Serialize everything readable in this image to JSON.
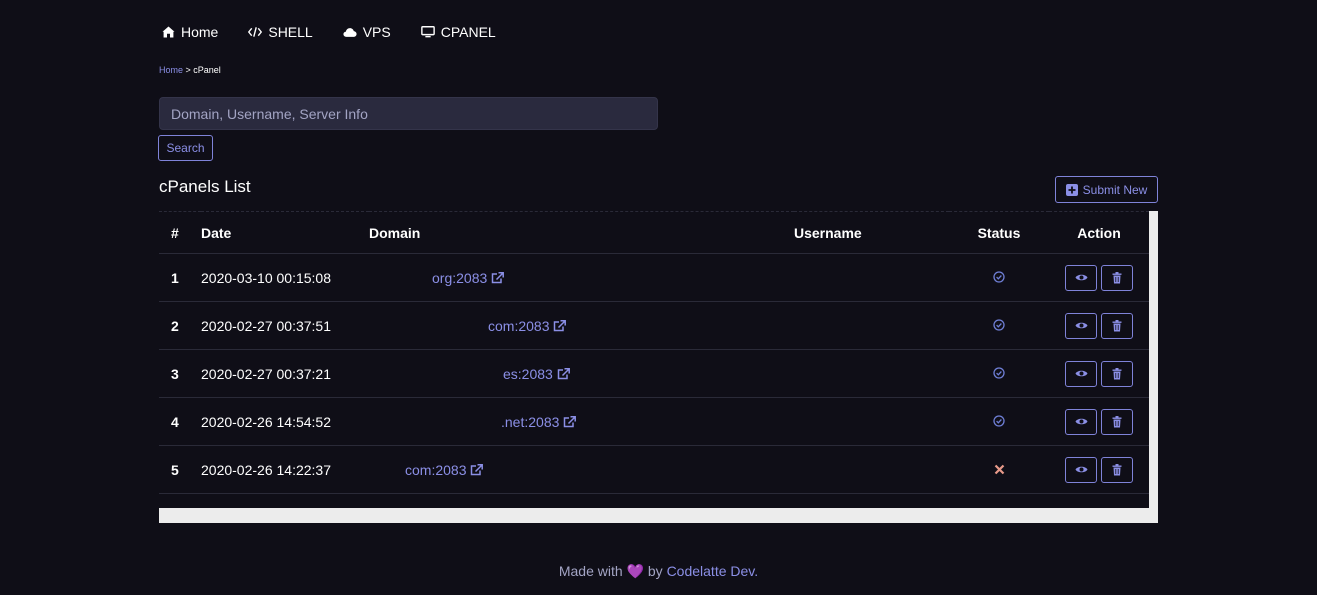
{
  "nav": {
    "items": [
      {
        "label": "Home",
        "icon": "home-icon"
      },
      {
        "label": "SHELL",
        "icon": "code-icon"
      },
      {
        "label": "VPS",
        "icon": "cloud-icon"
      },
      {
        "label": "CPANEL",
        "icon": "monitor-icon"
      }
    ]
  },
  "breadcrumb": {
    "home": "Home",
    "separator": " > ",
    "current": "cPanel"
  },
  "search": {
    "placeholder": "Domain, Username, Server Info",
    "value": "",
    "button_label": "Search"
  },
  "list": {
    "title": "cPanels List",
    "submit_label": "Submit New"
  },
  "table": {
    "headers": [
      "#",
      "Date",
      "Domain",
      "Username",
      "Status",
      "Action"
    ],
    "rows": [
      {
        "num": "1",
        "date": "2020-03-10 00:15:08",
        "domain": "org:2083",
        "username": "",
        "status": "ok"
      },
      {
        "num": "2",
        "date": "2020-02-27 00:37:51",
        "domain": "com:2083",
        "username": "",
        "status": "ok"
      },
      {
        "num": "3",
        "date": "2020-02-27 00:37:21",
        "domain": "es:2083",
        "username": "",
        "status": "ok"
      },
      {
        "num": "4",
        "date": "2020-02-26 14:54:52",
        "domain": ".net:2083",
        "username": "",
        "status": "ok"
      },
      {
        "num": "5",
        "date": "2020-02-26 14:22:37",
        "domain": "com:2083",
        "username": "",
        "status": "fail"
      }
    ]
  },
  "footer": {
    "prefix": "Made with",
    "heart": "💜",
    "middle": "by",
    "link": "Codelatte Dev."
  },
  "colors": {
    "background": "#0f0e17",
    "accent": "#8b8fe6",
    "status_ok": "#6f7fd6",
    "status_fail": "#e89a8a"
  }
}
